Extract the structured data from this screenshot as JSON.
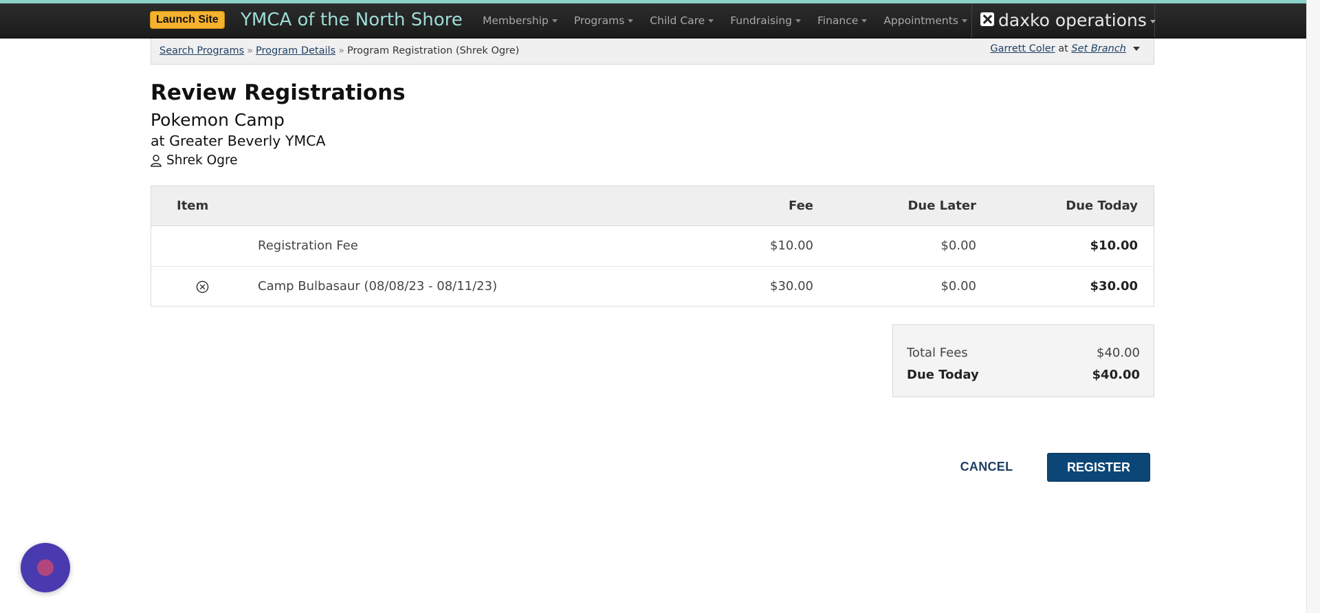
{
  "navbar": {
    "launch_label": "Launch Site",
    "org_name": "YMCA of the North Shore",
    "items": [
      {
        "label": "Membership"
      },
      {
        "label": "Programs"
      },
      {
        "label": "Child Care"
      },
      {
        "label": "Fundraising"
      },
      {
        "label": "Finance"
      },
      {
        "label": "Appointments"
      }
    ],
    "brand": "daxko operations"
  },
  "breadcrumb": {
    "items": [
      "Search Programs",
      "Program Details"
    ],
    "current": "Program Registration (Shrek Ogre)",
    "separator": "»"
  },
  "user": {
    "name": "Garrett Coler",
    "at": "at",
    "branch_link": "Set Branch"
  },
  "page": {
    "title": "Review Registrations",
    "program": "Pokemon Camp",
    "branch": "at Greater Beverly YMCA",
    "participant": "Shrek Ogre"
  },
  "table": {
    "headers": {
      "item": "Item",
      "fee": "Fee",
      "due_later": "Due Later",
      "due_today": "Due Today"
    },
    "rows": [
      {
        "description": "Registration Fee",
        "fee": "$10.00",
        "due_later": "$0.00",
        "due_today": "$10.00"
      },
      {
        "description": "Camp Bulbasaur (08/08/23 - 08/11/23)",
        "fee": "$30.00",
        "due_later": "$0.00",
        "due_today": "$30.00"
      }
    ]
  },
  "totals": {
    "total_fees_label": "Total Fees",
    "total_fees": "$40.00",
    "due_today_label": "Due Today",
    "due_today": "$40.00"
  },
  "actions": {
    "cancel": "CANCEL",
    "register": "REGISTER"
  },
  "colors": {
    "accent": "#0b4676",
    "launch": "#f5b22d",
    "org": "#9fdcd6",
    "chat": "#4a3ab0"
  }
}
